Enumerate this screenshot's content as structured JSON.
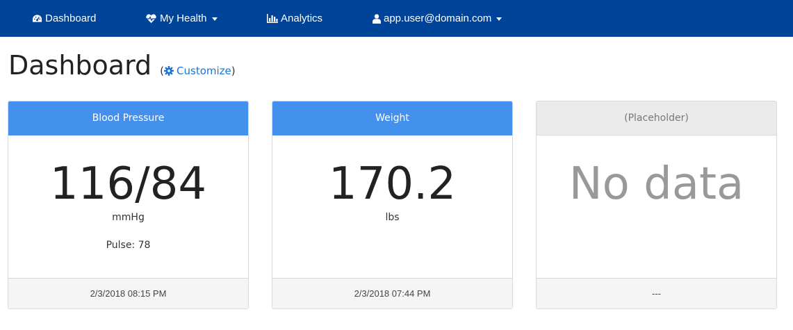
{
  "navbar": {
    "items": [
      {
        "label": "Dashboard",
        "icon": "dashboard-icon"
      },
      {
        "label": "My Health",
        "icon": "heartbeat-icon",
        "dropdown": true
      },
      {
        "label": "Analytics",
        "icon": "bar-chart-icon"
      },
      {
        "label": "app.user@domain.com",
        "icon": "user-icon",
        "dropdown": true
      }
    ]
  },
  "page": {
    "title": "Dashboard",
    "customize_open_paren": "(",
    "customize_label": "Customize",
    "customize_close_paren": ")"
  },
  "cards": [
    {
      "header": "Blood Pressure",
      "value": "116/84",
      "unit": "mmHg",
      "extra": "Pulse: 78",
      "footer": "2/3/2018 08:15 PM"
    },
    {
      "header": "Weight",
      "value": "170.2",
      "unit": "lbs",
      "footer": "2/3/2018 07:44 PM"
    },
    {
      "header": "(Placeholder)",
      "value": "No data",
      "footer": "---"
    }
  ],
  "colors": {
    "navbar": "#00449a",
    "card_header_active": "#4391ec",
    "card_header_placeholder": "#ebebeb",
    "link": "#1a73d9"
  }
}
